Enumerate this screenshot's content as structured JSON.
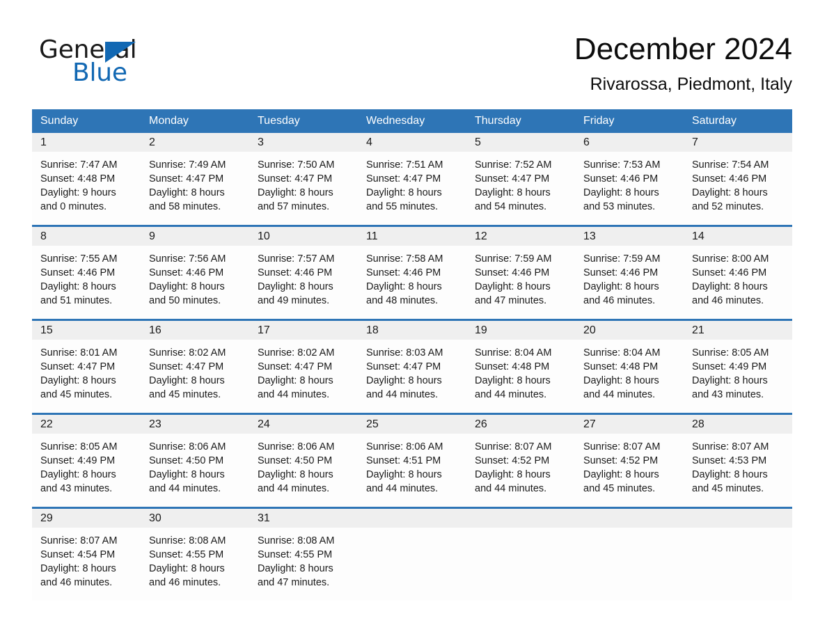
{
  "brand": {
    "word_one": "General",
    "word_two": "Blue",
    "triangle_icon": "brand-triangle-icon",
    "accent_color": "#1268b3"
  },
  "header": {
    "title": "December 2024",
    "location": "Rivarossa, Piedmont, Italy"
  },
  "theme": {
    "header_blue": "#2e75b6",
    "day_band_gray": "#efefef",
    "text_color": "#1a1a1a",
    "page_background": "#ffffff"
  },
  "weekdays": [
    "Sunday",
    "Monday",
    "Tuesday",
    "Wednesday",
    "Thursday",
    "Friday",
    "Saturday"
  ],
  "weeks": [
    [
      {
        "date": "1",
        "sunrise": "Sunrise: 7:47 AM",
        "sunset": "Sunset: 4:48 PM",
        "daylight_line1": "Daylight: 9 hours",
        "daylight_line2": "and 0 minutes."
      },
      {
        "date": "2",
        "sunrise": "Sunrise: 7:49 AM",
        "sunset": "Sunset: 4:47 PM",
        "daylight_line1": "Daylight: 8 hours",
        "daylight_line2": "and 58 minutes."
      },
      {
        "date": "3",
        "sunrise": "Sunrise: 7:50 AM",
        "sunset": "Sunset: 4:47 PM",
        "daylight_line1": "Daylight: 8 hours",
        "daylight_line2": "and 57 minutes."
      },
      {
        "date": "4",
        "sunrise": "Sunrise: 7:51 AM",
        "sunset": "Sunset: 4:47 PM",
        "daylight_line1": "Daylight: 8 hours",
        "daylight_line2": "and 55 minutes."
      },
      {
        "date": "5",
        "sunrise": "Sunrise: 7:52 AM",
        "sunset": "Sunset: 4:47 PM",
        "daylight_line1": "Daylight: 8 hours",
        "daylight_line2": "and 54 minutes."
      },
      {
        "date": "6",
        "sunrise": "Sunrise: 7:53 AM",
        "sunset": "Sunset: 4:46 PM",
        "daylight_line1": "Daylight: 8 hours",
        "daylight_line2": "and 53 minutes."
      },
      {
        "date": "7",
        "sunrise": "Sunrise: 7:54 AM",
        "sunset": "Sunset: 4:46 PM",
        "daylight_line1": "Daylight: 8 hours",
        "daylight_line2": "and 52 minutes."
      }
    ],
    [
      {
        "date": "8",
        "sunrise": "Sunrise: 7:55 AM",
        "sunset": "Sunset: 4:46 PM",
        "daylight_line1": "Daylight: 8 hours",
        "daylight_line2": "and 51 minutes."
      },
      {
        "date": "9",
        "sunrise": "Sunrise: 7:56 AM",
        "sunset": "Sunset: 4:46 PM",
        "daylight_line1": "Daylight: 8 hours",
        "daylight_line2": "and 50 minutes."
      },
      {
        "date": "10",
        "sunrise": "Sunrise: 7:57 AM",
        "sunset": "Sunset: 4:46 PM",
        "daylight_line1": "Daylight: 8 hours",
        "daylight_line2": "and 49 minutes."
      },
      {
        "date": "11",
        "sunrise": "Sunrise: 7:58 AM",
        "sunset": "Sunset: 4:46 PM",
        "daylight_line1": "Daylight: 8 hours",
        "daylight_line2": "and 48 minutes."
      },
      {
        "date": "12",
        "sunrise": "Sunrise: 7:59 AM",
        "sunset": "Sunset: 4:46 PM",
        "daylight_line1": "Daylight: 8 hours",
        "daylight_line2": "and 47 minutes."
      },
      {
        "date": "13",
        "sunrise": "Sunrise: 7:59 AM",
        "sunset": "Sunset: 4:46 PM",
        "daylight_line1": "Daylight: 8 hours",
        "daylight_line2": "and 46 minutes."
      },
      {
        "date": "14",
        "sunrise": "Sunrise: 8:00 AM",
        "sunset": "Sunset: 4:46 PM",
        "daylight_line1": "Daylight: 8 hours",
        "daylight_line2": "and 46 minutes."
      }
    ],
    [
      {
        "date": "15",
        "sunrise": "Sunrise: 8:01 AM",
        "sunset": "Sunset: 4:47 PM",
        "daylight_line1": "Daylight: 8 hours",
        "daylight_line2": "and 45 minutes."
      },
      {
        "date": "16",
        "sunrise": "Sunrise: 8:02 AM",
        "sunset": "Sunset: 4:47 PM",
        "daylight_line1": "Daylight: 8 hours",
        "daylight_line2": "and 45 minutes."
      },
      {
        "date": "17",
        "sunrise": "Sunrise: 8:02 AM",
        "sunset": "Sunset: 4:47 PM",
        "daylight_line1": "Daylight: 8 hours",
        "daylight_line2": "and 44 minutes."
      },
      {
        "date": "18",
        "sunrise": "Sunrise: 8:03 AM",
        "sunset": "Sunset: 4:47 PM",
        "daylight_line1": "Daylight: 8 hours",
        "daylight_line2": "and 44 minutes."
      },
      {
        "date": "19",
        "sunrise": "Sunrise: 8:04 AM",
        "sunset": "Sunset: 4:48 PM",
        "daylight_line1": "Daylight: 8 hours",
        "daylight_line2": "and 44 minutes."
      },
      {
        "date": "20",
        "sunrise": "Sunrise: 8:04 AM",
        "sunset": "Sunset: 4:48 PM",
        "daylight_line1": "Daylight: 8 hours",
        "daylight_line2": "and 44 minutes."
      },
      {
        "date": "21",
        "sunrise": "Sunrise: 8:05 AM",
        "sunset": "Sunset: 4:49 PM",
        "daylight_line1": "Daylight: 8 hours",
        "daylight_line2": "and 43 minutes."
      }
    ],
    [
      {
        "date": "22",
        "sunrise": "Sunrise: 8:05 AM",
        "sunset": "Sunset: 4:49 PM",
        "daylight_line1": "Daylight: 8 hours",
        "daylight_line2": "and 43 minutes."
      },
      {
        "date": "23",
        "sunrise": "Sunrise: 8:06 AM",
        "sunset": "Sunset: 4:50 PM",
        "daylight_line1": "Daylight: 8 hours",
        "daylight_line2": "and 44 minutes."
      },
      {
        "date": "24",
        "sunrise": "Sunrise: 8:06 AM",
        "sunset": "Sunset: 4:50 PM",
        "daylight_line1": "Daylight: 8 hours",
        "daylight_line2": "and 44 minutes."
      },
      {
        "date": "25",
        "sunrise": "Sunrise: 8:06 AM",
        "sunset": "Sunset: 4:51 PM",
        "daylight_line1": "Daylight: 8 hours",
        "daylight_line2": "and 44 minutes."
      },
      {
        "date": "26",
        "sunrise": "Sunrise: 8:07 AM",
        "sunset": "Sunset: 4:52 PM",
        "daylight_line1": "Daylight: 8 hours",
        "daylight_line2": "and 44 minutes."
      },
      {
        "date": "27",
        "sunrise": "Sunrise: 8:07 AM",
        "sunset": "Sunset: 4:52 PM",
        "daylight_line1": "Daylight: 8 hours",
        "daylight_line2": "and 45 minutes."
      },
      {
        "date": "28",
        "sunrise": "Sunrise: 8:07 AM",
        "sunset": "Sunset: 4:53 PM",
        "daylight_line1": "Daylight: 8 hours",
        "daylight_line2": "and 45 minutes."
      }
    ],
    [
      {
        "date": "29",
        "sunrise": "Sunrise: 8:07 AM",
        "sunset": "Sunset: 4:54 PM",
        "daylight_line1": "Daylight: 8 hours",
        "daylight_line2": "and 46 minutes."
      },
      {
        "date": "30",
        "sunrise": "Sunrise: 8:08 AM",
        "sunset": "Sunset: 4:55 PM",
        "daylight_line1": "Daylight: 8 hours",
        "daylight_line2": "and 46 minutes."
      },
      {
        "date": "31",
        "sunrise": "Sunrise: 8:08 AM",
        "sunset": "Sunset: 4:55 PM",
        "daylight_line1": "Daylight: 8 hours",
        "daylight_line2": "and 47 minutes."
      },
      {
        "date": "",
        "sunrise": "",
        "sunset": "",
        "daylight_line1": "",
        "daylight_line2": ""
      },
      {
        "date": "",
        "sunrise": "",
        "sunset": "",
        "daylight_line1": "",
        "daylight_line2": ""
      },
      {
        "date": "",
        "sunrise": "",
        "sunset": "",
        "daylight_line1": "",
        "daylight_line2": ""
      },
      {
        "date": "",
        "sunrise": "",
        "sunset": "",
        "daylight_line1": "",
        "daylight_line2": ""
      }
    ]
  ]
}
